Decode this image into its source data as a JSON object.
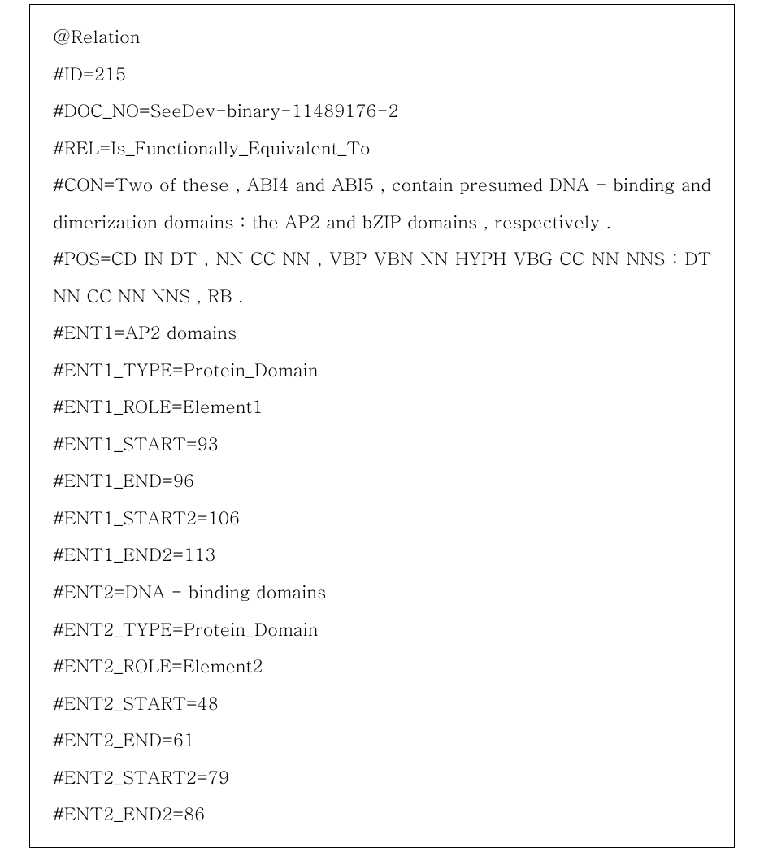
{
  "lines": {
    "l1": "@Relation",
    "l2": "#ID=215",
    "l3": "#DOC_NO=SeeDev-binary-11489176-2",
    "l4": "#REL=Is_Functionally_Equivalent_To",
    "l5": "#CON=Two of these , ABI4 and ABI5 , contain presumed DNA - binding and dimerization domains : the AP2 and bZIP domains , respectively .",
    "l6": "#POS=CD IN DT , NN CC NN , VBP VBN NN HYPH VBG CC NN NNS : DT NN CC NN NNS , RB .",
    "l7": "#ENT1=AP2 domains",
    "l8": "#ENT1_TYPE=Protein_Domain",
    "l9": "#ENT1_ROLE=Element1",
    "l10": "#ENT1_START=93",
    "l11": "#ENT1_END=96",
    "l12": "#ENT1_START2=106",
    "l13": "#ENT1_END2=113",
    "l14": "#ENT2=DNA - binding domains",
    "l15": "#ENT2_TYPE=Protein_Domain",
    "l16": "#ENT2_ROLE=Element2",
    "l17": "#ENT2_START=48",
    "l18": "#ENT2_END=61",
    "l19": "#ENT2_START2=79",
    "l20": "#ENT2_END2=86"
  }
}
